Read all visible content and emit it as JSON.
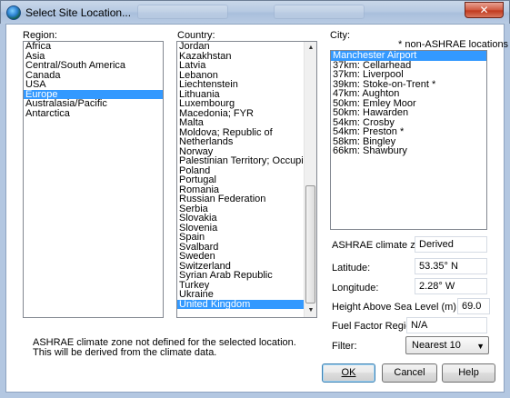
{
  "window": {
    "title": "Select Site Location...",
    "close_glyph": "✕"
  },
  "region": {
    "label": "Region:",
    "items": [
      "Africa",
      "Asia",
      "Central/South America",
      "Canada",
      "USA",
      "Europe",
      "Australasia/Pacific",
      "Antarctica"
    ],
    "selected": "Europe"
  },
  "country": {
    "label": "Country:",
    "items": [
      "Jordan",
      "Kazakhstan",
      "Latvia",
      "Lebanon",
      "Liechtenstein",
      "Lithuania",
      "Luxembourg",
      "Macedonia; FYR",
      "Malta",
      "Moldova; Republic of",
      "Netherlands",
      "Norway",
      "Palestinian Territory; Occupied",
      "Poland",
      "Portugal",
      "Romania",
      "Russian Federation",
      "Serbia",
      "Slovakia",
      "Slovenia",
      "Spain",
      "Svalbard",
      "Sweden",
      "Switzerland",
      "Syrian Arab Republic",
      "Turkey",
      "Ukraine",
      "United Kingdom"
    ],
    "selected": "United Kingdom"
  },
  "city": {
    "label": "City:",
    "note": "* non-ASHRAE locations",
    "items": [
      "Manchester Airport",
      "37km: Cellarhead",
      "37km: Liverpool",
      "39km: Stoke-on-Trent *",
      "47km: Aughton",
      "50km: Emley Moor",
      "50km: Hawarden",
      "54km: Crosby",
      "54km: Preston *",
      "58km: Bingley",
      "66km: Shawbury"
    ],
    "selected": "Manchester Airport"
  },
  "fields": {
    "climate_zone_label": "ASHRAE climate zone:",
    "climate_zone_value": "Derived",
    "latitude_label": "Latitude:",
    "latitude_value": "53.35° N",
    "longitude_label": "Longitude:",
    "longitude_value": "2.28° W",
    "height_label": "Height Above Sea Level (m):",
    "height_value": "69.0",
    "fuel_label": "Fuel Factor Region:",
    "fuel_value": "N/A",
    "filter_label": "Filter:",
    "filter_value": "Nearest 10"
  },
  "message": "ASHRAE climate zone not defined for the selected location. This will be derived from the climate data.",
  "buttons": {
    "ok": "OK",
    "cancel": "Cancel",
    "help": "Help"
  },
  "colors": {
    "selection": "#3399ff",
    "titlebar": "#b7cae2",
    "close": "#c0391e"
  }
}
